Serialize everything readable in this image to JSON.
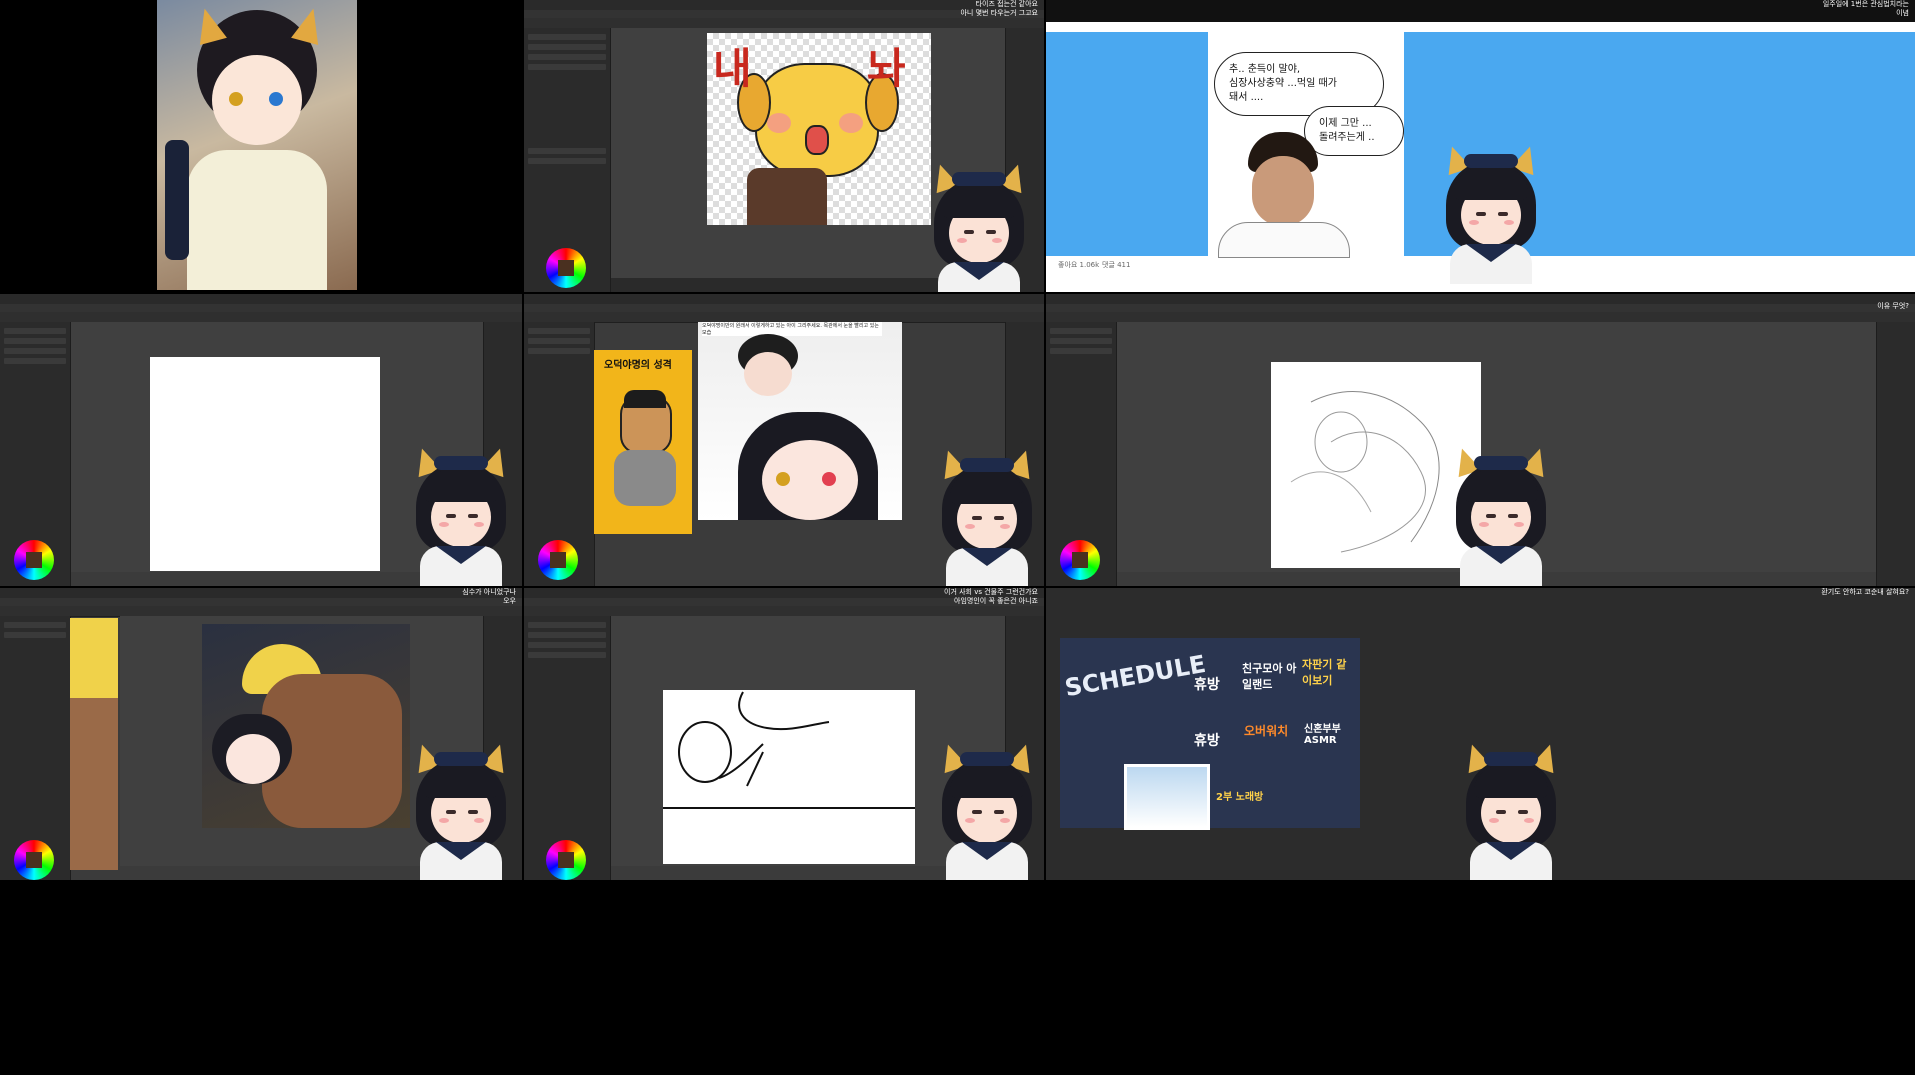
{
  "cell1": {
    "description_hidden": ""
  },
  "cell2": {
    "title_overlay_line1": "타이즈 접는건 같아요",
    "title_overlay_line2": "아니 몇번 타우는거 그고요",
    "sticker_text_left": "내",
    "sticker_text_right": "놔"
  },
  "cell3": {
    "title_overlay_line1": "일주일에 1번은 관심법치라는",
    "title_overlay_line2": "이념",
    "bubble1_line1": "추.. 춘득이 말야,",
    "bubble1_line2": "심장사상충약 ...먹일 때가",
    "bubble1_line3": "돼서 ....",
    "bubble2_line1": "이제 그만 ...",
    "bubble2_line2": "돌려주는게 ..",
    "likes": "좋아요 1.06k",
    "comments": "댓글 411"
  },
  "cell5": {
    "yellow_card_title": "오덕야명의 성격",
    "caption": "오덕야명이만의 원래서 이렇게하고 있는 아이 그리주세요. 목관에서 눈을 빨리고 있는 모습"
  },
  "cell6": {
    "title_overlay": "이유 무엇?"
  },
  "cell7": {
    "title_overlay_line1": "심수가 아니었구나",
    "title_overlay_line2": "오우"
  },
  "cell8": {
    "title_overlay_line1": "이거 사회 vs 건물주 그런건가요",
    "title_overlay_line2": "아임명인이 꼭 좋은건 아니죠"
  },
  "cell9": {
    "title_overlay_line1": "환기도 안하고 코순내 살혀요?",
    "schedule": {
      "title": "SCHEDULE",
      "items": [
        "휴방",
        "친구모아 아일랜드",
        "자판기 같이보기",
        "휴방",
        "오버워치",
        "신혼부부 ASMR",
        "2부 노래방"
      ]
    }
  },
  "colors": {
    "app_bg": "#3b3b3b",
    "panel_bg": "#2b2b2b",
    "sky_blue": "#4aa8f0",
    "yellow_card": "#f2b51a",
    "red_text": "#c8281e"
  }
}
